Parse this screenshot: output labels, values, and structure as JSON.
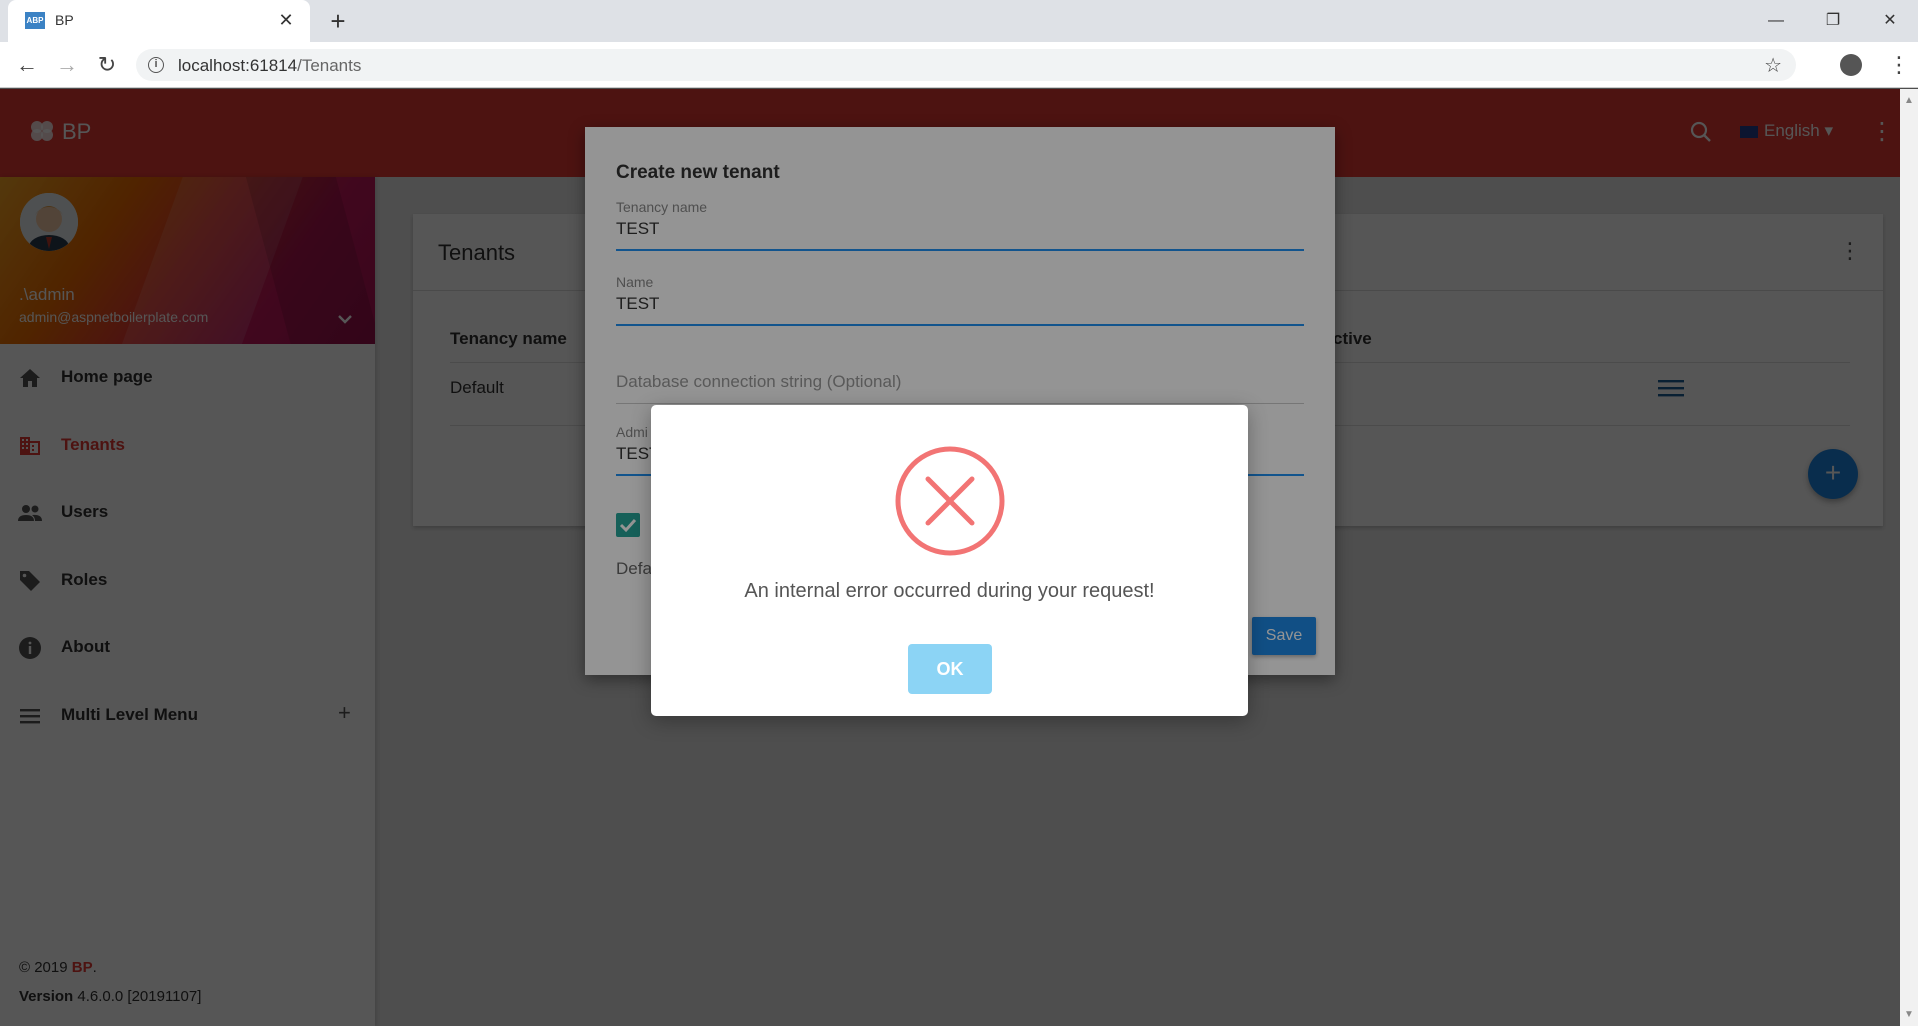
{
  "browser": {
    "tab_title": "BP",
    "tab_favicon": "ABP",
    "url_host": "localhost:61814",
    "url_path": "/Tenants"
  },
  "header": {
    "logo_text": "BP",
    "language": "English",
    "accent_color": "#e53935"
  },
  "user": {
    "name": ".\\admin",
    "email": "admin@aspnetboilerplate.com"
  },
  "sidebar": {
    "items": [
      {
        "label": "Home page",
        "icon": "home-icon"
      },
      {
        "label": "Tenants",
        "icon": "building-icon",
        "active": true
      },
      {
        "label": "Users",
        "icon": "people-icon"
      },
      {
        "label": "Roles",
        "icon": "tag-icon"
      },
      {
        "label": "About",
        "icon": "info-icon"
      },
      {
        "label": "Multi Level Menu",
        "icon": "menu-icon",
        "expand": "+"
      }
    ],
    "footer_copyright": "© 2019",
    "footer_brand": "BP",
    "footer_dot": ".",
    "footer_version_label": "Version",
    "footer_version_value": "4.6.0.0 [20191107]"
  },
  "tenants_card": {
    "title": "Tenants",
    "col_tenancy_name": "Tenancy name",
    "col_active": "ctive",
    "rows": [
      {
        "tenancy_name": "Default"
      }
    ],
    "fab": "+"
  },
  "modal": {
    "title": "Create new tenant",
    "tenancy_name_label": "Tenancy name",
    "tenancy_name_value": "TEST",
    "name_label": "Name",
    "name_value": "TEST",
    "connection_placeholder": "Database connection string (Optional)",
    "admin_label": "Admi",
    "admin_value": "TEST",
    "default_text": "Defa",
    "save_label": "Save"
  },
  "alert": {
    "message": "An internal error occurred during your request!",
    "ok_label": "OK"
  }
}
